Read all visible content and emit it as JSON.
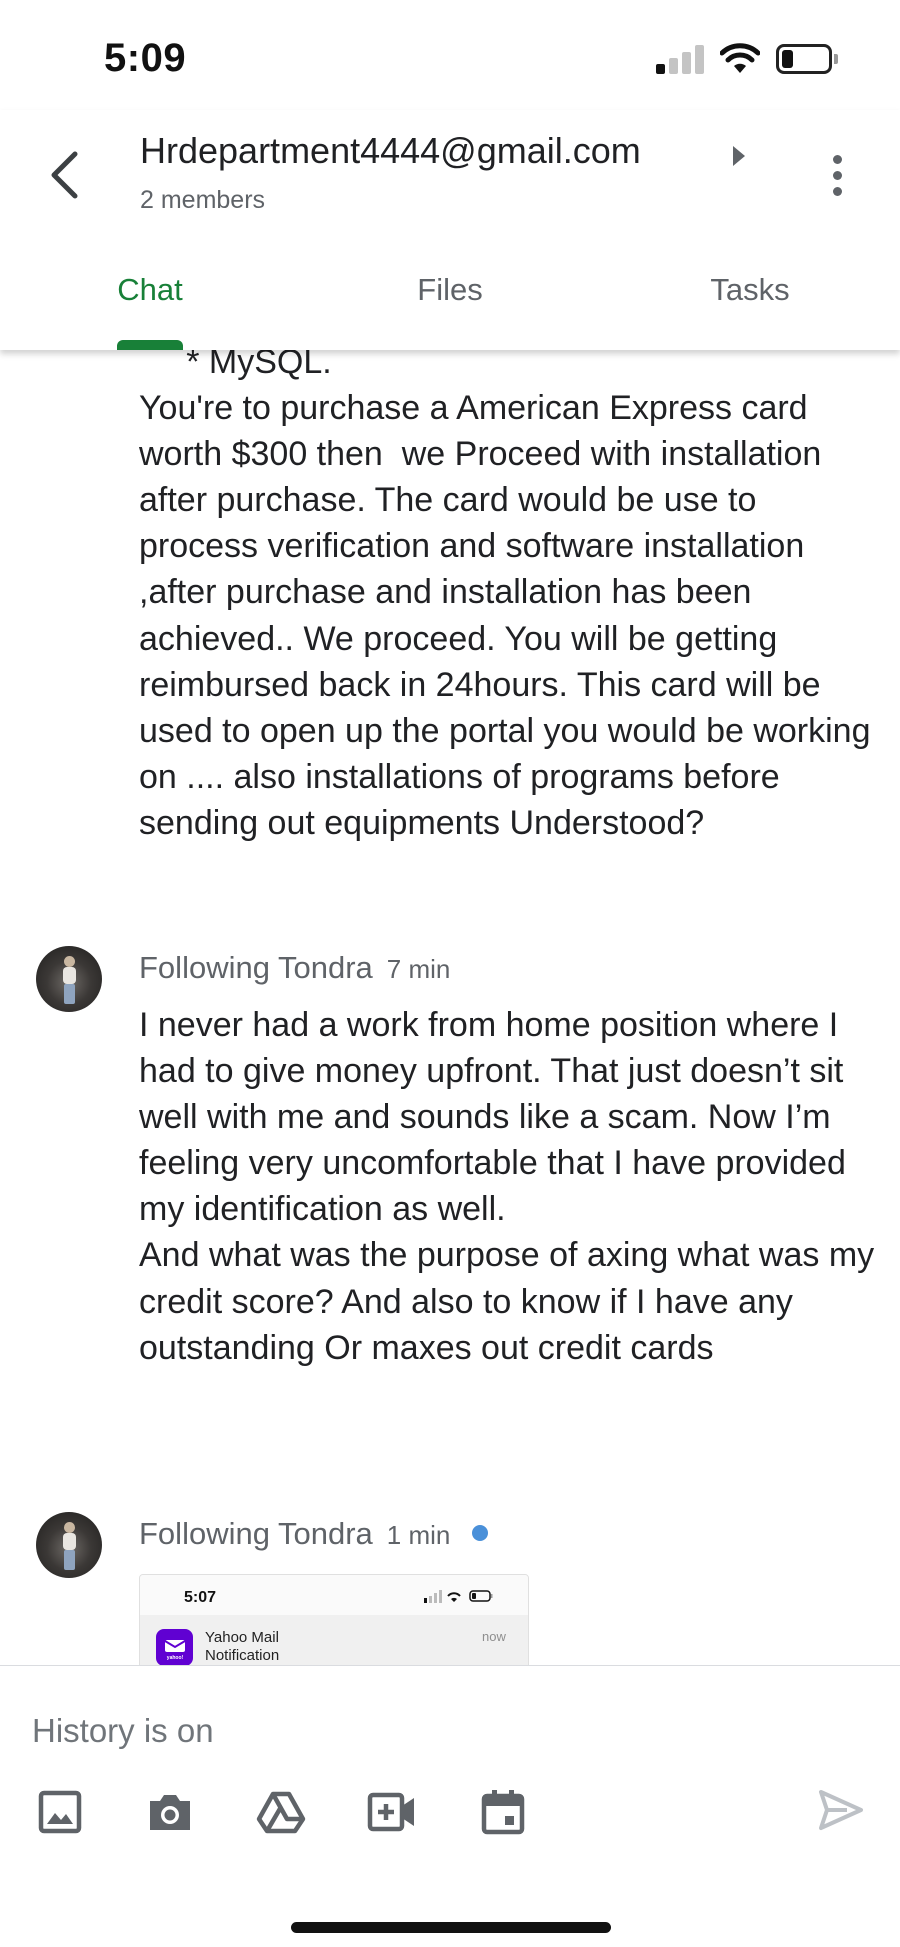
{
  "status_bar": {
    "time": "5:09"
  },
  "header": {
    "title": "Hrdepartment4444@gmail.com",
    "members": "2 members"
  },
  "tabs": [
    {
      "label": "Chat",
      "active": true
    },
    {
      "label": "Files",
      "active": false
    },
    {
      "label": "Tasks",
      "active": false
    }
  ],
  "messages": [
    {
      "text": "     * MySQL.\nYou're to purchase a American Express card worth $300 then  we Proceed with installation after purchase. The card would be use to process verification and software installation ,after purchase and installation has been achieved.. We proceed. You will be getting reimbursed back in 24hours. This card will be used to open up the portal you would be working on .... also installations of programs before sending out equipments Understood?"
    },
    {
      "sender": "Following Tondra",
      "time": "7 min",
      "text": "I never had a work from home position where I had to give money upfront. That just doesn’t sit well with me and sounds like a scam. Now I’m feeling very uncomfortable that I have provided my identification as well.\nAnd what was the purpose of axing what was my credit score? And also to know if I have any outstanding Or maxes out credit cards"
    },
    {
      "sender": "Following Tondra",
      "time": "1 min",
      "unread": true,
      "attachment": {
        "time": "5:07",
        "app_name": "Yahoo Mail",
        "notification_type": "Notification",
        "timestamp": "now",
        "app_icon_text": "yahoo!"
      }
    }
  ],
  "composer": {
    "placeholder": "History is on",
    "tools": [
      "image-icon",
      "camera-icon",
      "drive-icon",
      "video-call-icon",
      "calendar-icon"
    ],
    "send": "send-icon"
  },
  "colors": {
    "accent": "#188038",
    "unread_dot": "#4a90d9",
    "secondary_text": "#5f6368",
    "icon_gray": "#5f6368",
    "send_disabled": "#bdc1c6"
  }
}
